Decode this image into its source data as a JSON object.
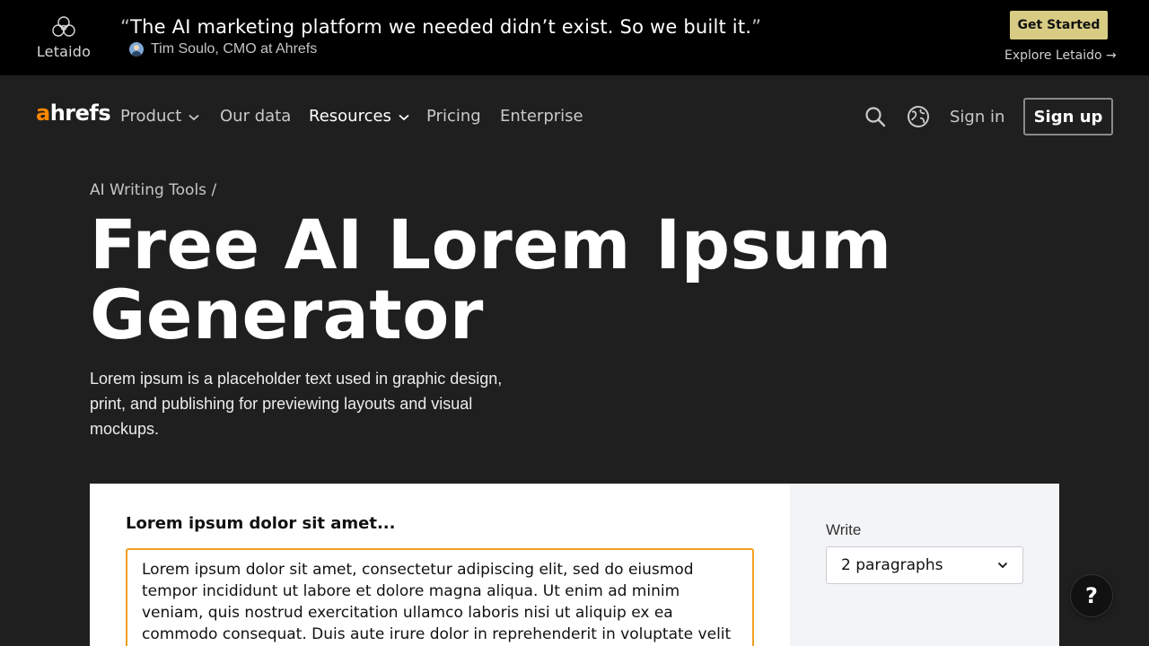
{
  "promo": {
    "logo_text": "Letaido",
    "quote_open": "“",
    "quote": "The AI marketing platform we needed didn’t exist. So we built it.",
    "quote_close": "”",
    "author": "Tim Soulo, CMO at Ahrefs",
    "cta": "Get Started",
    "explore": "Explore Letaido →",
    "cta_color": "#d8cc84"
  },
  "nav": {
    "brand_a": "a",
    "brand_rest": "hrefs",
    "brand_accent": "#ff8800",
    "items": [
      {
        "label": "Product",
        "has_menu": true
      },
      {
        "label": "Our data",
        "has_menu": false
      },
      {
        "label": "Resources",
        "has_menu": true
      },
      {
        "label": "Pricing",
        "has_menu": false
      },
      {
        "label": "Enterprise",
        "has_menu": false
      }
    ],
    "sign_in": "Sign in",
    "sign_up": "Sign up"
  },
  "hero": {
    "breadcrumb": "AI Writing Tools /",
    "title_line1": "Free AI Lorem Ipsum",
    "title_line2": "Generator",
    "description": "Lorem ipsum is a placeholder text used in graphic design, print, and publishing for previewing layouts and visual mockups."
  },
  "tool": {
    "heading": "Lorem ipsum dolor sit amet...",
    "input_value": "Lorem ipsum dolor sit amet, consectetur adipiscing elit, sed do eiusmod tempor incididunt ut labore et dolore magna aliqua. Ut enim ad minim veniam, quis nostrud exercitation ullamco laboris nisi ut aliquip ex ea commodo consequat. Duis aute irure dolor in reprehenderit in voluptate velit",
    "input_border_color": "#f0a020",
    "write_label": "Write",
    "write_selected": "2 paragraphs"
  },
  "help": {
    "label": "?"
  }
}
